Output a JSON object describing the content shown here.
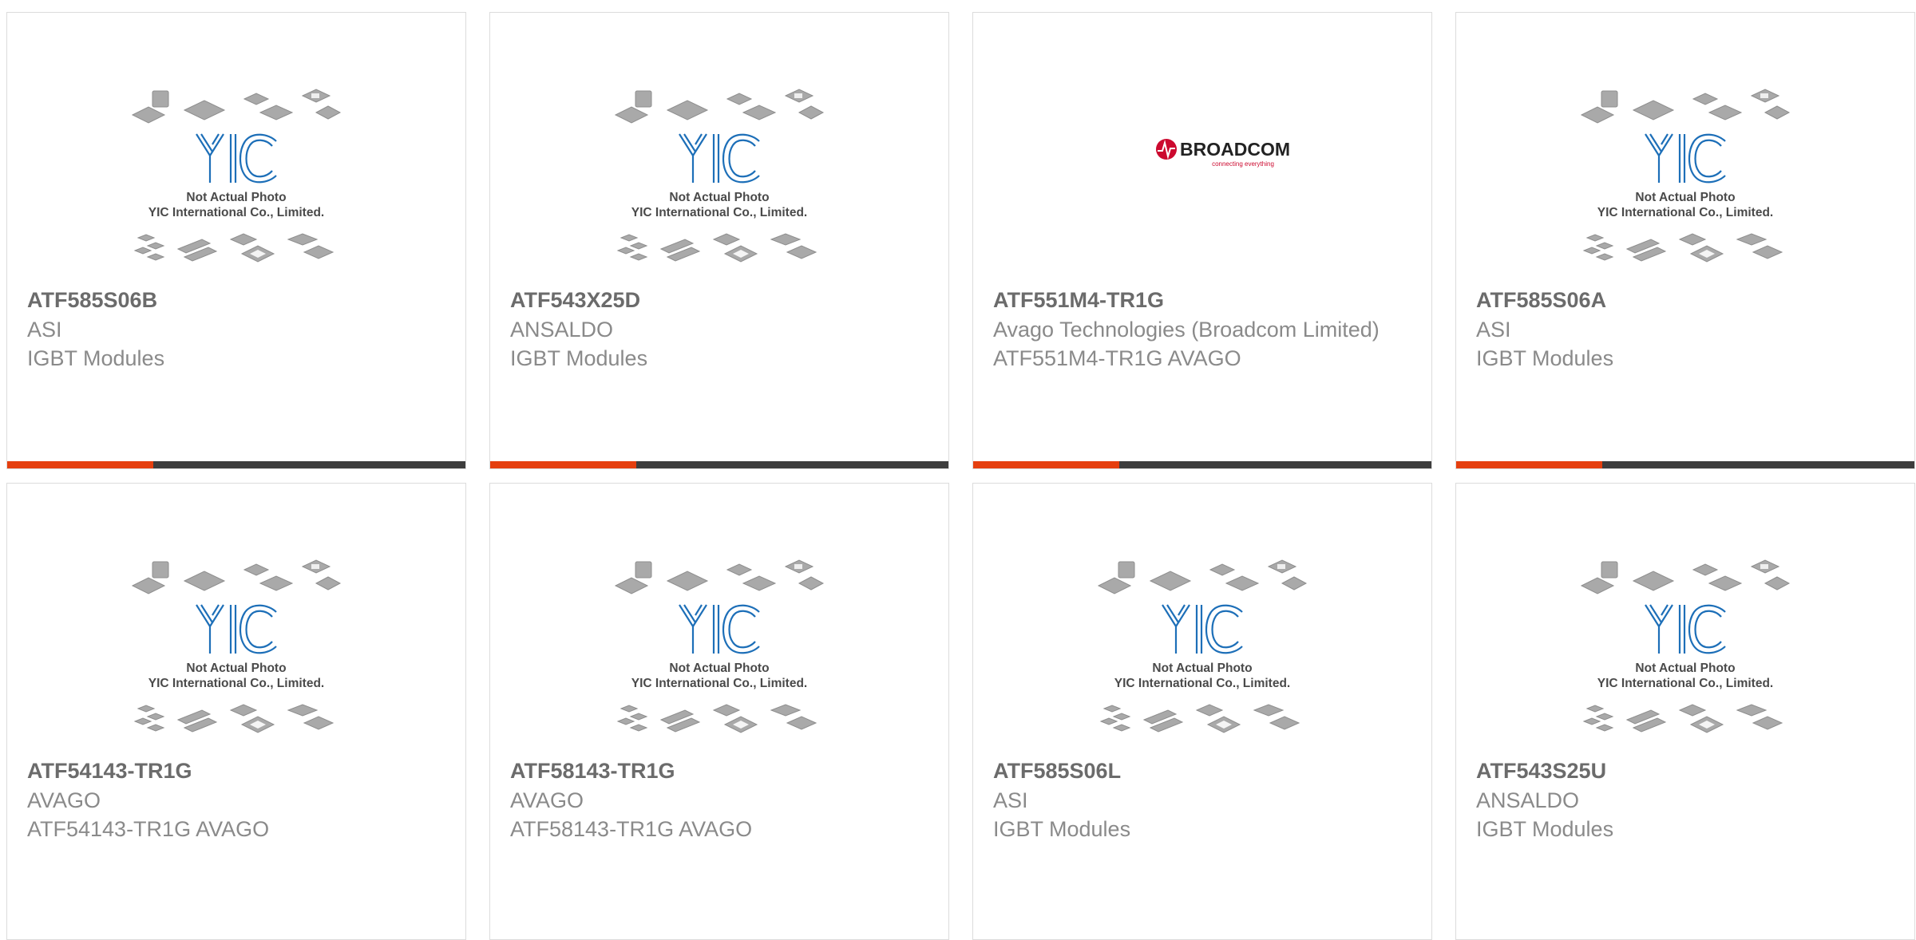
{
  "colors": {
    "accent_bar": "#e53f0f",
    "dark_bar": "#3d3d3d",
    "yic_logo_blue": "#1d6fb8",
    "broadcom_red": "#cc092f"
  },
  "placeholder_image": {
    "icon": "yic-placeholder-icon",
    "line1": "Not Actual Photo",
    "line2": "YIC International Co., Limited."
  },
  "broadcom_image": {
    "icon": "broadcom-logo",
    "brand": "BROADCOM",
    "tagline": "connecting everything"
  },
  "products": [
    {
      "part_number": "ATF585S06B",
      "manufacturer": "ASI",
      "description": "IGBT Modules",
      "image": "yic-placeholder"
    },
    {
      "part_number": "ATF543X25D",
      "manufacturer": "ANSALDO",
      "description": "IGBT Modules",
      "image": "yic-placeholder"
    },
    {
      "part_number": "ATF551M4-TR1G",
      "manufacturer": "Avago Technologies (Broadcom Limited)",
      "description": "ATF551M4-TR1G AVAGO",
      "image": "broadcom"
    },
    {
      "part_number": "ATF585S06A",
      "manufacturer": "ASI",
      "description": "IGBT Modules",
      "image": "yic-placeholder"
    },
    {
      "part_number": "ATF54143-TR1G",
      "manufacturer": "AVAGO",
      "description": "ATF54143-TR1G AVAGO",
      "image": "yic-placeholder"
    },
    {
      "part_number": "ATF58143-TR1G",
      "manufacturer": "AVAGO",
      "description": "ATF58143-TR1G AVAGO",
      "image": "yic-placeholder"
    },
    {
      "part_number": "ATF585S06L",
      "manufacturer": "ASI",
      "description": "IGBT Modules",
      "image": "yic-placeholder"
    },
    {
      "part_number": "ATF543S25U",
      "manufacturer": "ANSALDO",
      "description": "IGBT Modules",
      "image": "yic-placeholder"
    }
  ]
}
